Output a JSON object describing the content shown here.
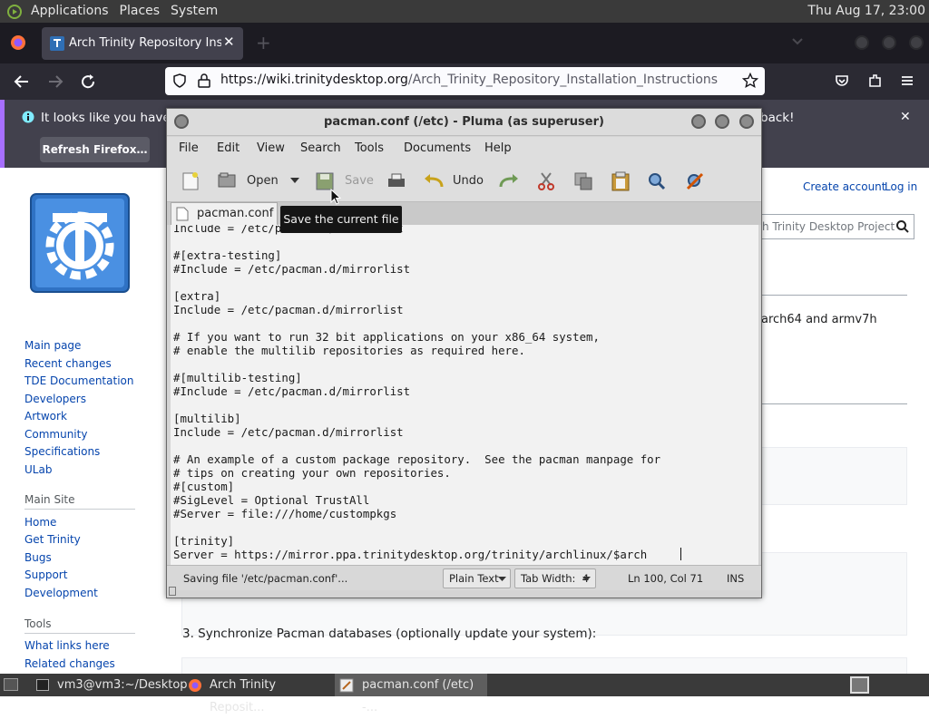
{
  "top_panel": {
    "menus": [
      "Applications",
      "Places",
      "System"
    ],
    "clock": "Thu Aug 17, 23:00"
  },
  "firefox": {
    "tab_title": "Arch Trinity Repository Installa",
    "url_host": "https://wiki.trinitydesktop.org",
    "url_path": "/Arch_Trinity_Repository_Installation_Instructions",
    "notification": "It looks like you haven’t",
    "notification_tail": "back!",
    "refresh_button": "Refresh Firefox…"
  },
  "wiki": {
    "create_account": "Create account",
    "log_in": "Log in",
    "search_placeholder": "h Trinity Desktop Project",
    "body_fragment": "arch64 and armv7h",
    "step3": "3. Synchronize Pacman databases (optionally update your system):",
    "nav": [
      "Main page",
      "Recent changes",
      "TDE Documentation",
      "Developers",
      "Artwork",
      "Community",
      "Specifications",
      "ULab"
    ],
    "main_site_heading": "Main Site",
    "main_site": [
      "Home",
      "Get Trinity",
      "Bugs",
      "Support",
      "Development"
    ],
    "tools_heading": "Tools",
    "tools": [
      "What links here",
      "Related changes"
    ]
  },
  "pluma": {
    "title": "pacman.conf (/etc) - Pluma (as superuser)",
    "menus": [
      "File",
      "Edit",
      "View",
      "Search",
      "Tools",
      "Documents",
      "Help"
    ],
    "toolbar": {
      "open": "Open",
      "save": "Save",
      "undo": "Undo"
    },
    "doc_tab": "pacman.conf",
    "tooltip": "Save the current file",
    "lines": [
      "Include = /etc/pacman.d/mirrorlist",
      "",
      "#[extra-testing]",
      "#Include = /etc/pacman.d/mirrorlist",
      "",
      "[extra]",
      "Include = /etc/pacman.d/mirrorlist",
      "",
      "# If you want to run 32 bit applications on your x86_64 system,",
      "# enable the multilib repositories as required here.",
      "",
      "#[multilib-testing]",
      "#Include = /etc/pacman.d/mirrorlist",
      "",
      "[multilib]",
      "Include = /etc/pacman.d/mirrorlist",
      "",
      "# An example of a custom package repository.  See the pacman manpage for",
      "# tips on creating your own repositories.",
      "#[custom]",
      "#SigLevel = Optional TrustAll",
      "#Server = file:///home/custompkgs",
      "",
      "[trinity]",
      "Server = https://mirror.ppa.trinitydesktop.org/trinity/archlinux/$arch"
    ],
    "status": {
      "message": "Saving file '/etc/pacman.conf'...",
      "language": "Plain Text",
      "tab_width": "Tab Width:  4",
      "position": "Ln 100, Col 71",
      "mode": "INS"
    }
  },
  "taskbar": {
    "items": [
      "vm3@vm3:~/Desktop",
      "Arch Trinity Reposit...",
      "pacman.conf (/etc) -..."
    ]
  }
}
